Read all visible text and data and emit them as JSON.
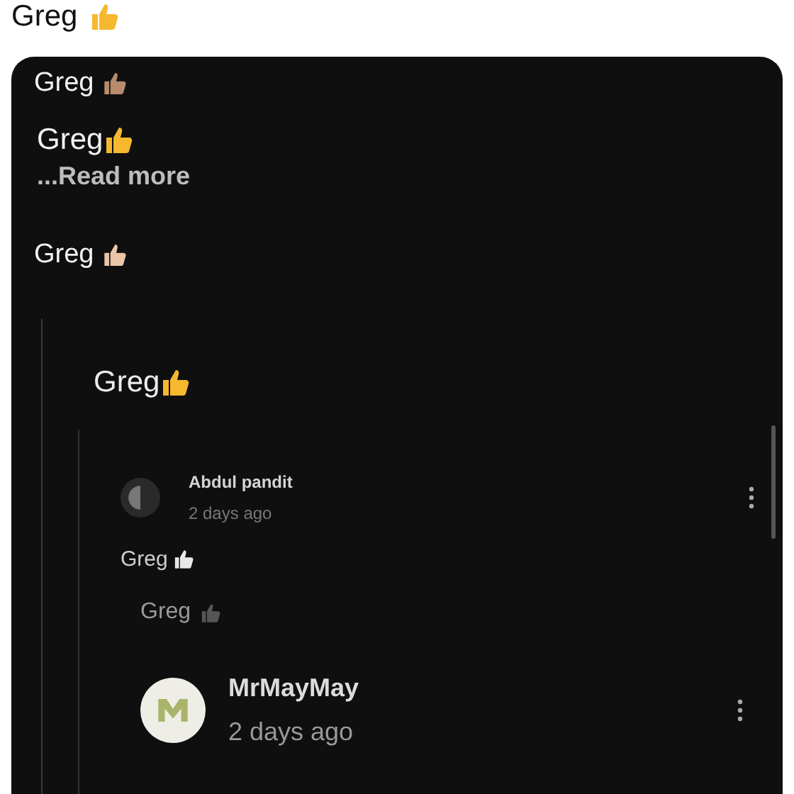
{
  "post": {
    "text": "Greg",
    "color": "#f5b82e"
  },
  "screenshot": {
    "lines": [
      {
        "kind": "plain",
        "text": "Greg",
        "color": "#b88b6d"
      },
      {
        "kind": "large",
        "text": "Greg",
        "color": "#f5b82e"
      },
      {
        "kind": "more",
        "text": "...Read more"
      },
      {
        "kind": "plain",
        "text": "Greg",
        "color": "#e9c6a8"
      }
    ],
    "replies": [
      {
        "kind": "large",
        "text": "Greg",
        "color": "#f5b82e",
        "children": [
          {
            "kind": "comment-small",
            "author": "Abdul pandit",
            "time": "2 days ago"
          },
          {
            "kind": "small",
            "text": "Greg",
            "color": "#e8e8e8"
          },
          {
            "kind": "faint",
            "text": "Greg",
            "color": "#555555"
          },
          {
            "kind": "comment",
            "author": "MrMayMay",
            "time": "2 days ago"
          }
        ]
      }
    ]
  }
}
